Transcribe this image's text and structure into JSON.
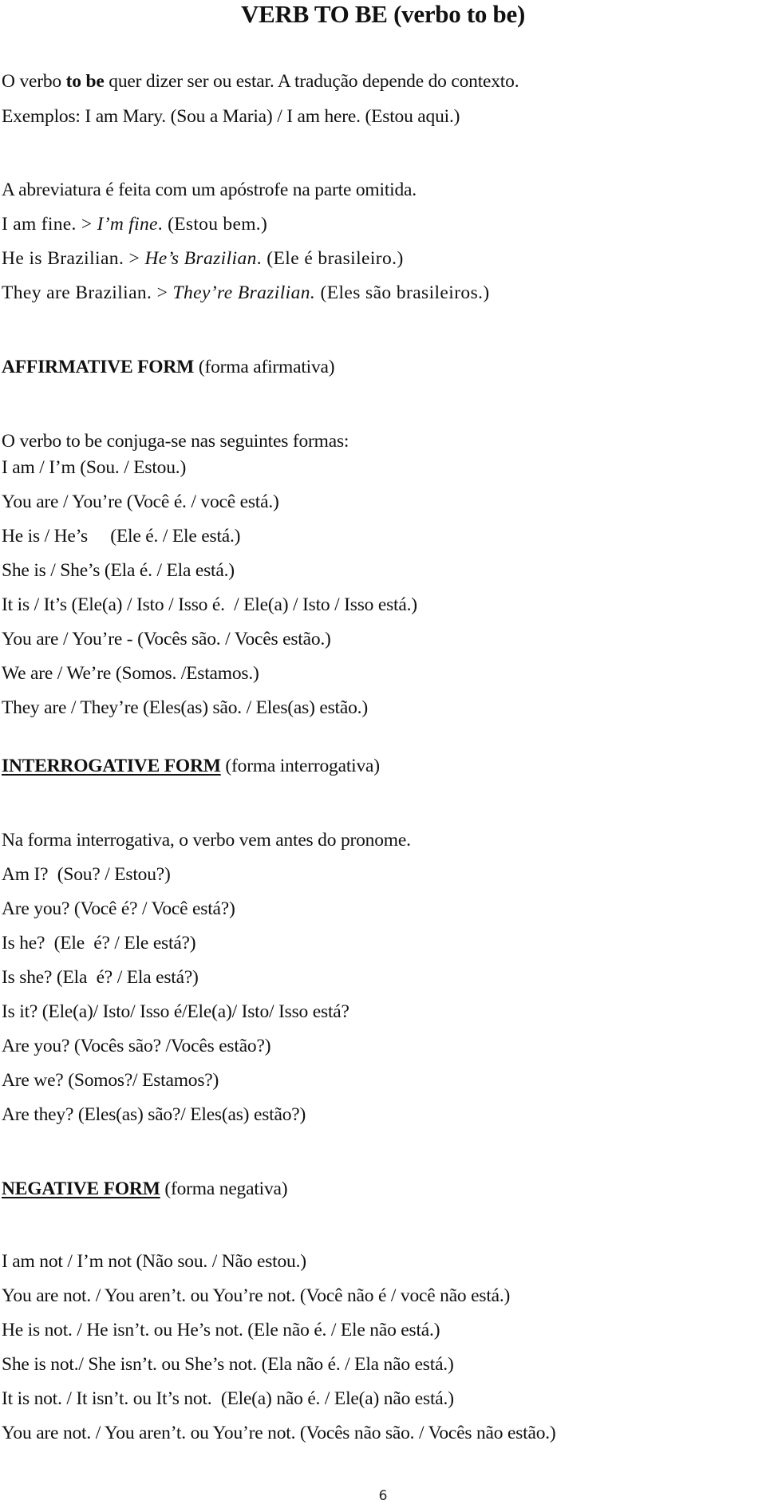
{
  "title": "VERB TO BE (verbo to be)",
  "intro": {
    "line1": {
      "pre": "O verbo ",
      "bold": "to be",
      "post": " quer dizer ser ou estar. A tradução depende do contexto."
    },
    "line2": "Exemplos: I am Mary. (Sou a Maria) / I am here. (Estou aqui.)"
  },
  "abbreviation": {
    "text": "A abreviatura é feita com um apóstrofe na parte omitida.",
    "examples": [
      {
        "full": "I am fine. > ",
        "short": "I’m fine",
        "translation": ". (Estou bem.)"
      },
      {
        "full": "He is Brazilian. > ",
        "short": "He’s Brazilian",
        "translation": ". (Ele é brasileiro.)"
      },
      {
        "full": "They are Brazilian. > ",
        "short": "They’re Brazilian.",
        "translation": " (Eles são brasileiros.)"
      }
    ]
  },
  "affirmative": {
    "heading_bold": "AFFIRMATIVE FORM",
    "heading_rest": " (forma afirmativa)",
    "intro": "O verbo to be conjuga-se nas seguintes formas:",
    "lines": [
      "I am / I’m (Sou. / Estou.)",
      "You are / You’re (Você é. / você está.)",
      "He is / He’s     (Ele é. / Ele está.)",
      "She is / She’s (Ela é. / Ela está.)",
      "It is / It’s (Ele(a) / Isto / Isso é.  / Ele(a) / Isto / Isso está.)",
      "You are / You’re - (Vocês são. / Vocês estão.)",
      "We are / We’re (Somos. /Estamos.)",
      "They are / They’re (Eles(as) são. / Eles(as) estão.)"
    ]
  },
  "interrogative": {
    "heading_bold": "INTERROGATIVE FORM",
    "heading_rest": " (forma interrogativa)",
    "intro": "Na forma interrogativa, o verbo vem antes do pronome.",
    "lines": [
      "Am I?  (Sou? / Estou?)",
      "Are you? (Você é? / Você está?)",
      "Is he?  (Ele  é? / Ele está?)",
      "Is she? (Ela  é? / Ela está?)",
      "Is it? (Ele(a)/ Isto/ Isso é/Ele(a)/ Isto/ Isso está?",
      "Are you? (Vocês são? /Vocês estão?)",
      "Are we? (Somos?/ Estamos?)",
      "Are they? (Eles(as) são?/ Eles(as) estão?)"
    ]
  },
  "negative": {
    "heading_bold": "NEGATIVE FORM",
    "heading_rest": " (forma negativa)",
    "lines": [
      "I am not / I’m not (Não sou. / Não estou.)",
      "You are not. / You aren’t. ou You’re not. (Você não é / você não está.)",
      "He is not. / He isn’t. ou He’s not. (Ele não é. / Ele não está.)",
      "She is not./ She isn’t. ou She’s not. (Ela não é. / Ela não está.)",
      "It is not. / It isn’t. ou It’s not.  (Ele(a) não é. / Ele(a) não está.)",
      "You are not. / You aren’t. ou You’re not. (Vocês não são. / Vocês não estão.)"
    ]
  },
  "page_number": "6"
}
